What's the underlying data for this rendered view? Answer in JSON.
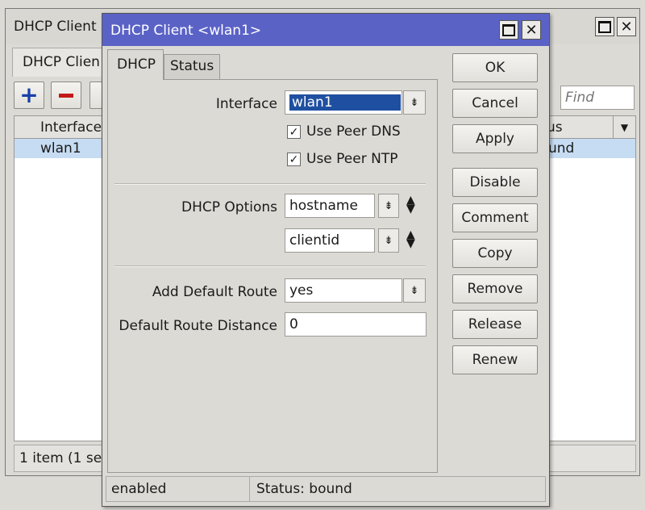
{
  "bg_window": {
    "title": "DHCP Client",
    "tab_label": "DHCP Clien",
    "find_placeholder": "Find",
    "col_interface": "Interface",
    "col_status": "us",
    "row_interface": "wlan1",
    "row_status": "und",
    "footer": "1 item (1 se"
  },
  "dialog": {
    "title": "DHCP Client <wlan1>",
    "tabs": [
      "DHCP",
      "Status"
    ],
    "interface_label": "Interface",
    "interface_value": "wlan1",
    "use_peer_dns_label": "Use Peer DNS",
    "use_peer_ntp_label": "Use Peer NTP",
    "dhcp_options_label": "DHCP Options",
    "dhcp_option_1": "hostname",
    "dhcp_option_2": "clientid",
    "add_default_route_label": "Add Default Route",
    "add_default_route_value": "yes",
    "default_route_distance_label": "Default Route Distance",
    "default_route_distance_value": "0",
    "status_left": "enabled",
    "status_right": "Status: bound"
  },
  "buttons": {
    "ok": "OK",
    "cancel": "Cancel",
    "apply": "Apply",
    "disable": "Disable",
    "comment": "Comment",
    "copy": "Copy",
    "remove": "Remove",
    "release": "Release",
    "renew": "Renew"
  },
  "colors": {
    "dialog_title_bg": "#5a62c6",
    "selection": "#1f4fa0",
    "row_highlight": "#c6dcf2"
  }
}
